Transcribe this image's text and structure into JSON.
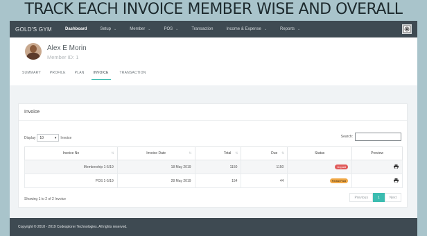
{
  "banner": "TRACK EACH INVOICE MEMBER WISE AND OVERALL",
  "nav": {
    "brand": "GOLD'S GYM",
    "items": [
      {
        "label": "Dashboard",
        "caret": false
      },
      {
        "label": "Setup",
        "caret": true
      },
      {
        "label": "Member",
        "caret": true
      },
      {
        "label": "POS",
        "caret": true
      },
      {
        "label": "Transaction",
        "caret": false
      },
      {
        "label": "Income & Expense",
        "caret": true
      },
      {
        "label": "Reports",
        "caret": true
      }
    ]
  },
  "member": {
    "name": "Alex E Morin",
    "id": "Member ID: 1"
  },
  "tabs": [
    "SUMMARY",
    "PROFILE",
    "PLAN",
    "INVOICE",
    "TRANSACTION"
  ],
  "invoice": {
    "title": "Invoice",
    "display_label": "Display",
    "length_value": "10",
    "length_suffix": "Invoice",
    "search_label": "Search:",
    "columns": [
      "Invoice No",
      "Invoice Date",
      "Total",
      "Due",
      "Status",
      "Preview"
    ],
    "rows": [
      {
        "no": "Membership 1-5/19",
        "date": "18 May 2019",
        "total": "1150",
        "due": "1150",
        "status": "Unpaid"
      },
      {
        "no": "POS 1-5/19",
        "date": "28 May 2019",
        "total": "154",
        "due": "44",
        "status": "Partial Paid"
      }
    ],
    "info": "Showing 1 to 2 of 2 Invoice",
    "pager": {
      "prev": "Previous",
      "current": "1",
      "next": "Next"
    }
  },
  "footer": "Copyright © 2018 - 2019 Codesplorer Technologies. All rights reserved.",
  "colors": {
    "accent": "#3bbcb0",
    "nav_bg": "#3e4a52",
    "unpaid": "#e05a5a",
    "partial": "#f0a846"
  }
}
